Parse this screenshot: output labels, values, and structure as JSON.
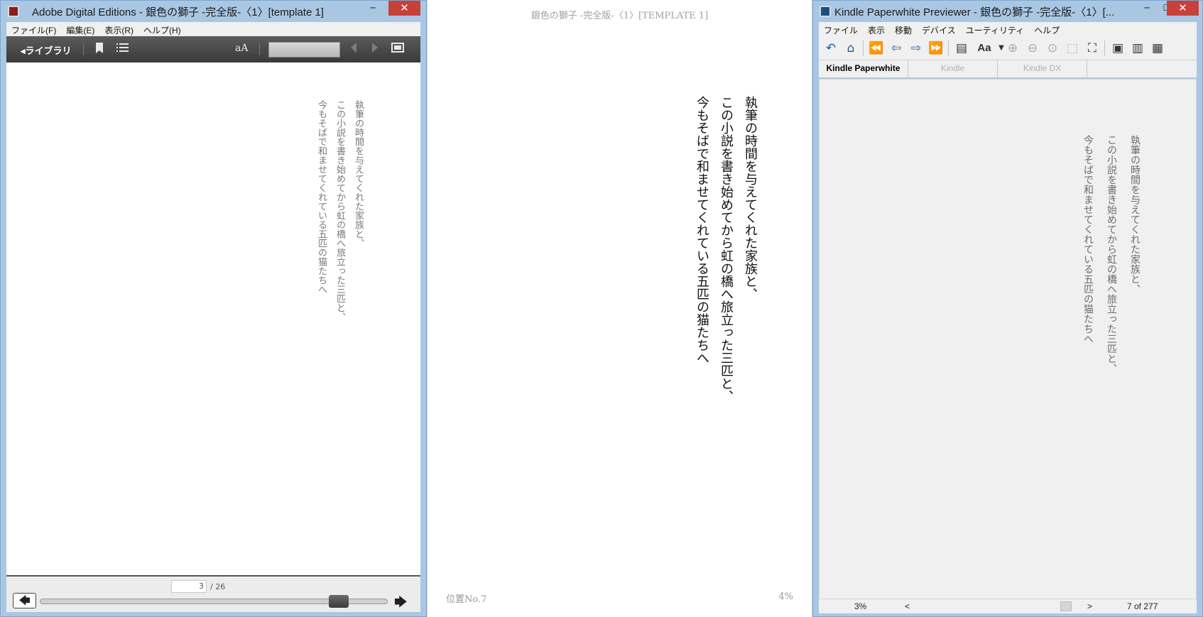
{
  "ade": {
    "title": "Adobe Digital Editions - 銀色の獅子 -完全版-〈1〉[template 1]",
    "menu": [
      "ファイル(F)",
      "編集(E)",
      "表示(R)",
      "ヘルプ(H)"
    ],
    "toolbar": {
      "library_label": "◂ライブラリ",
      "font_size_icon": "aA",
      "bookmark_icon": "bookmark-icon",
      "toc_icon": "list-icon",
      "fullscreen_icon": "fullscreen-icon"
    },
    "lines": [
      "執筆の時間を与えてくれた家族と、",
      "この小説を書き始めてから虹の橋へ旅立った三匹と、",
      "今もそばで和ませてくれている五匹の猫たちへ"
    ],
    "page_current": "3",
    "page_total": "/ 26",
    "progress": 0.86,
    "controls": {
      "minimize": "─",
      "maximize": "☐",
      "close": "✕"
    }
  },
  "middle": {
    "header": "銀色の獅子 -完全版-〈1〉[TEMPLATE 1]",
    "lines": [
      "執筆の時間を与えてくれた家族と、",
      "この小説を書き始めてから虹の橋へ旅立った三匹と、",
      "今もそばで和ませてくれている五匹の猫たちへ"
    ],
    "location": "位置No.7",
    "percent": "4%"
  },
  "kpp": {
    "title": "Kindle Paperwhite Previewer - 銀色の獅子 -完全版-〈1〉[...",
    "menu": [
      "ファイル",
      "表示",
      "移動",
      "デバイス",
      "ユーティリティ",
      "ヘルプ"
    ],
    "tabs": [
      "Kindle Paperwhite",
      "Kindle",
      "Kindle DX"
    ],
    "lines": [
      "執筆の時間を与えてくれた家族と、",
      "この小説を書き始めてから虹の橋へ旅立った三匹と、",
      "今もそばで和ませてくれている五匹の猫たちへ"
    ],
    "status_percent": "3%",
    "status_prev": "<",
    "status_next": ">",
    "status_location": "7 of 277",
    "font_label": "Aa",
    "controls": {
      "minimize": "─",
      "maximize": "☐",
      "close": "✕"
    }
  },
  "colors": {
    "chrome": "#a9c7e3",
    "close": "#c7413a",
    "ade_toolbar": "#4a4a4a",
    "kpp_icon": "#1c5a9e"
  }
}
